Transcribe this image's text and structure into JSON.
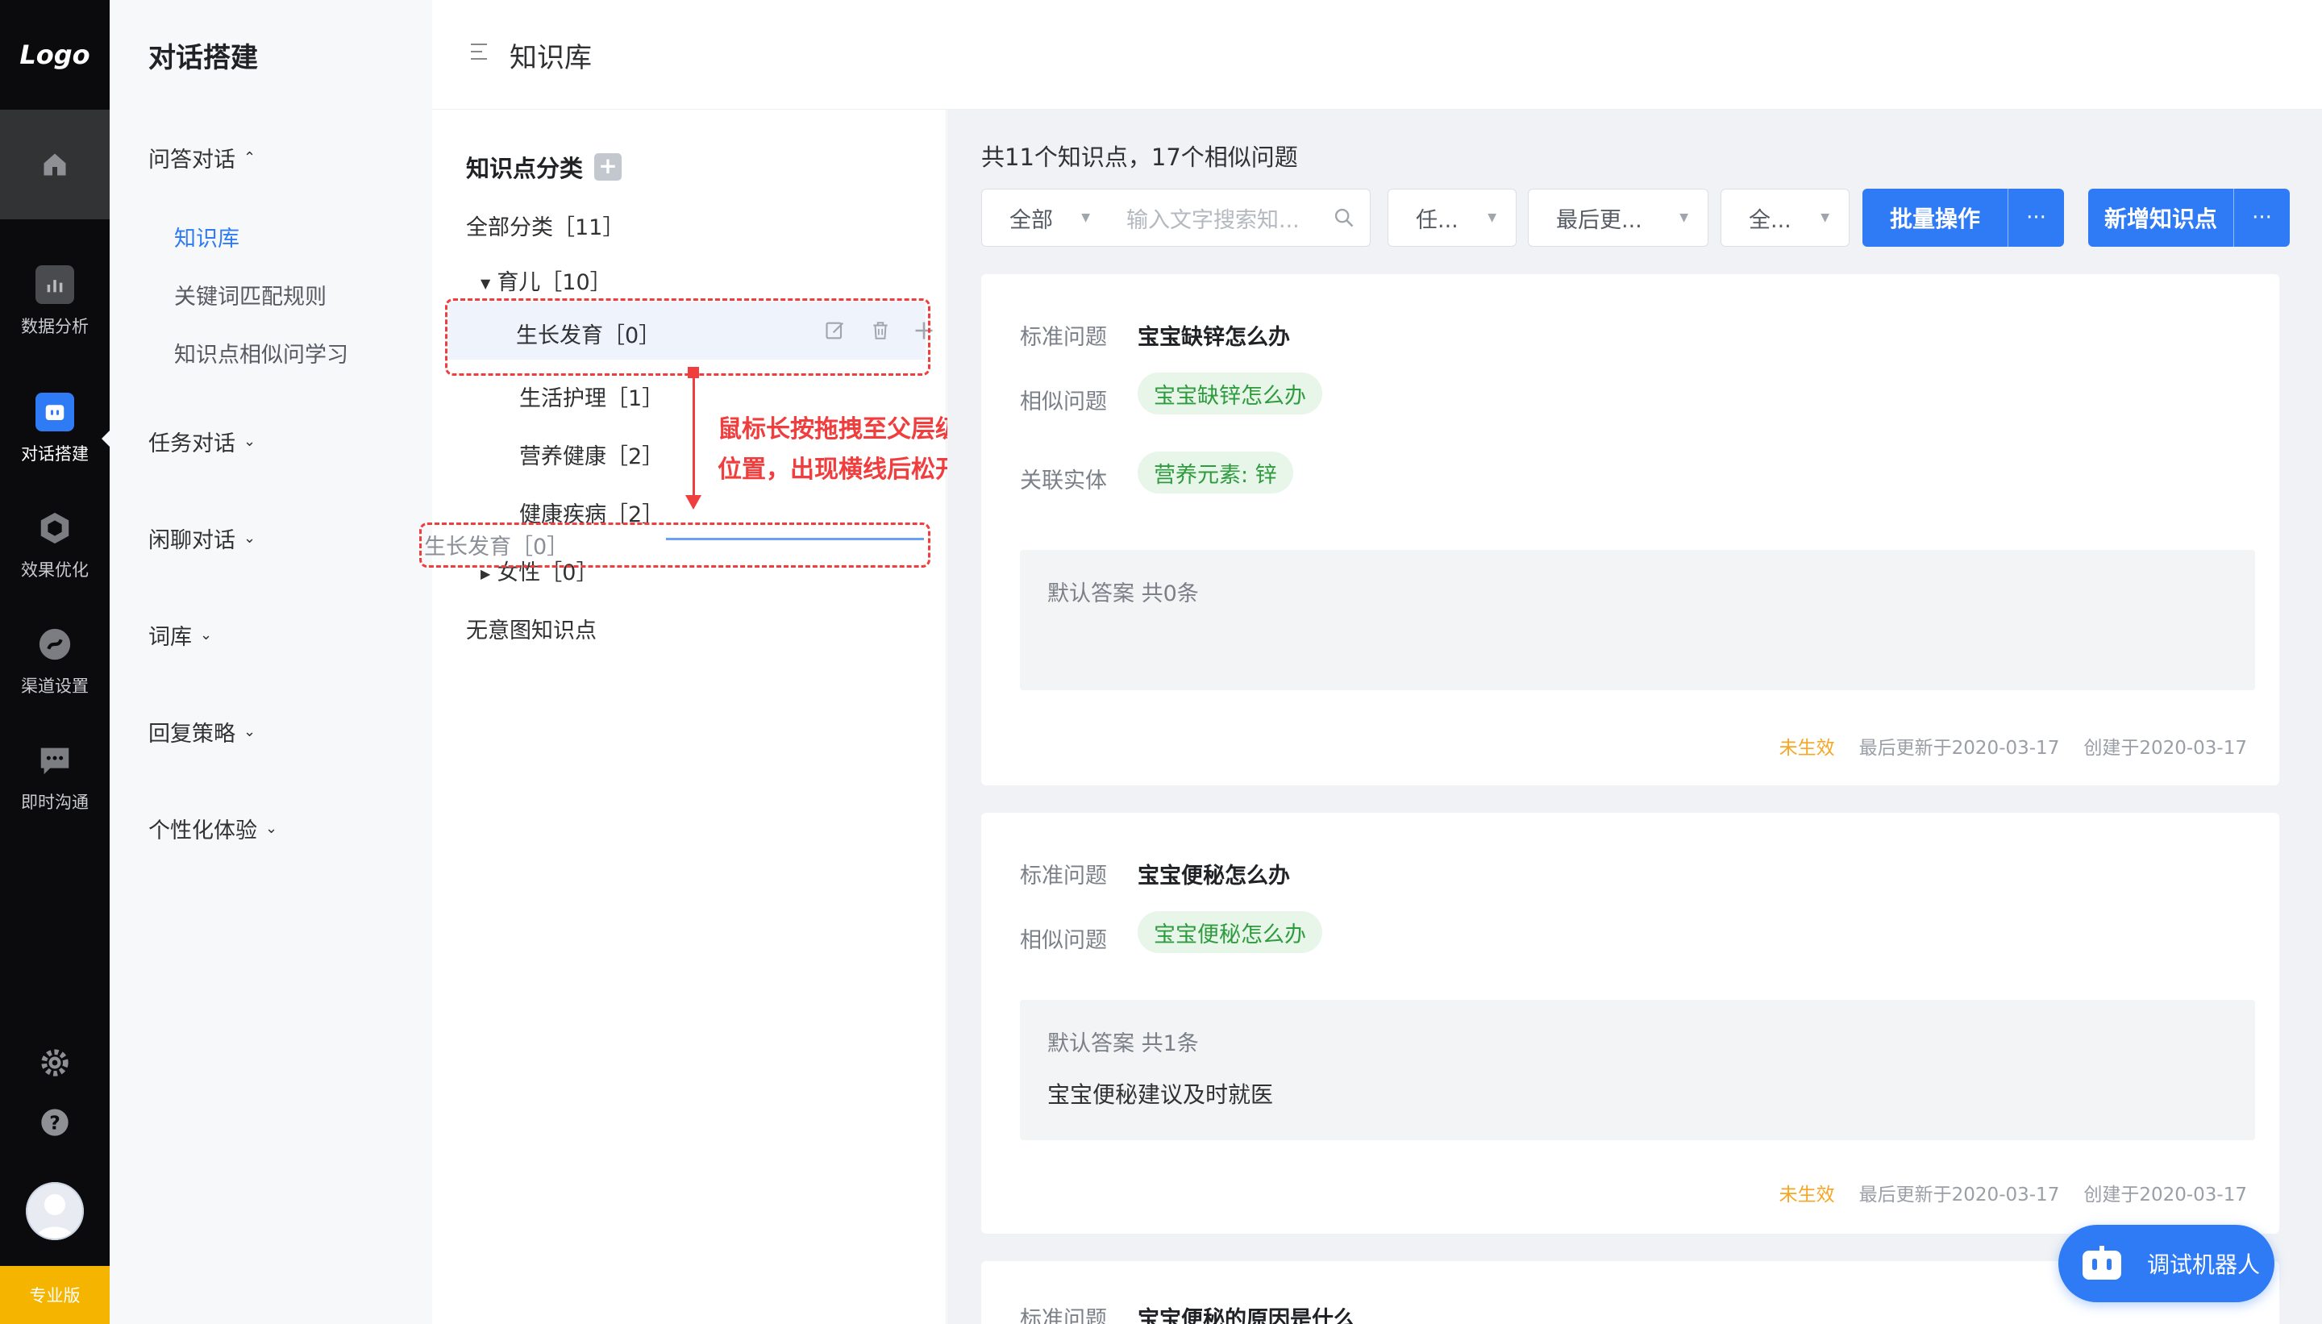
{
  "rail": {
    "logo": "Logo",
    "items": [
      {
        "label": "数据分析",
        "icon": "bar-chart-icon"
      },
      {
        "label": "对话搭建",
        "icon": "robot-icon"
      },
      {
        "label": "效果优化",
        "icon": "cube-icon"
      },
      {
        "label": "渠道设置",
        "icon": "channel-icon"
      },
      {
        "label": "即时沟通",
        "icon": "chat-bubble-icon"
      }
    ],
    "active_item": "对话搭建",
    "badge": "专业版"
  },
  "menu": {
    "title": "对话搭建",
    "groups": [
      {
        "label": "问答对话",
        "expanded": true,
        "children": [
          "知识库",
          "关键词匹配规则",
          "知识点相似问学习"
        ]
      },
      {
        "label": "任务对话"
      },
      {
        "label": "闲聊对话"
      },
      {
        "label": "词库"
      },
      {
        "label": "回复策略"
      },
      {
        "label": "个性化体验"
      }
    ],
    "active_child": "知识库"
  },
  "header": {
    "title": "知识库"
  },
  "tree": {
    "title": "知识点分类",
    "all": "全部分类［11］",
    "parent": "育儿［10］",
    "children": [
      "生长发育［0］",
      "生活护理［1］",
      "营养健康［2］",
      "健康疾病［2］"
    ],
    "female": "女性［0］",
    "none": "无意图知识点",
    "ghost": "生长发育［0］",
    "annotation": [
      "鼠标长按拖拽至父层级",
      "位置，出现横线后松开"
    ]
  },
  "main": {
    "summary": "共11个知识点，17个相似问题",
    "filters": {
      "scope": "全部",
      "search_placeholder": "输入文字搜索知...",
      "f2": "任...",
      "f3": "最后更...",
      "f4": "全..."
    },
    "batch_button": "批量操作",
    "add_button": "新增知识点",
    "more": "···",
    "labels": {
      "standard": "标准问题",
      "similar": "相似问题",
      "entity": "关联实体"
    },
    "cards": [
      {
        "standard": "宝宝缺锌怎么办",
        "similar": "宝宝缺锌怎么办",
        "entity": "营养元素: 锌",
        "answer_header": "默认答案  共0条",
        "status": "未生效",
        "updated": "最后更新于2020-03-17",
        "created": "创建于2020-03-17"
      },
      {
        "standard": "宝宝便秘怎么办",
        "similar": "宝宝便秘怎么办",
        "answer_header": "默认答案  共1条",
        "answer": "宝宝便秘建议及时就医",
        "status": "未生效",
        "updated": "最后更新于2020-03-17",
        "created": "创建于2020-03-17"
      },
      {
        "standard": "宝宝便秘的原因是什么"
      }
    ],
    "robot_button": "调试机器人"
  },
  "colors": {
    "primary": "#2f7bf5",
    "rail_bg": "#0b0b0d",
    "tag_green": "#2e9b3e",
    "status_orange": "#f5a623",
    "annotation_red": "#f03d3d",
    "badge_yellow": "#f5b400"
  }
}
